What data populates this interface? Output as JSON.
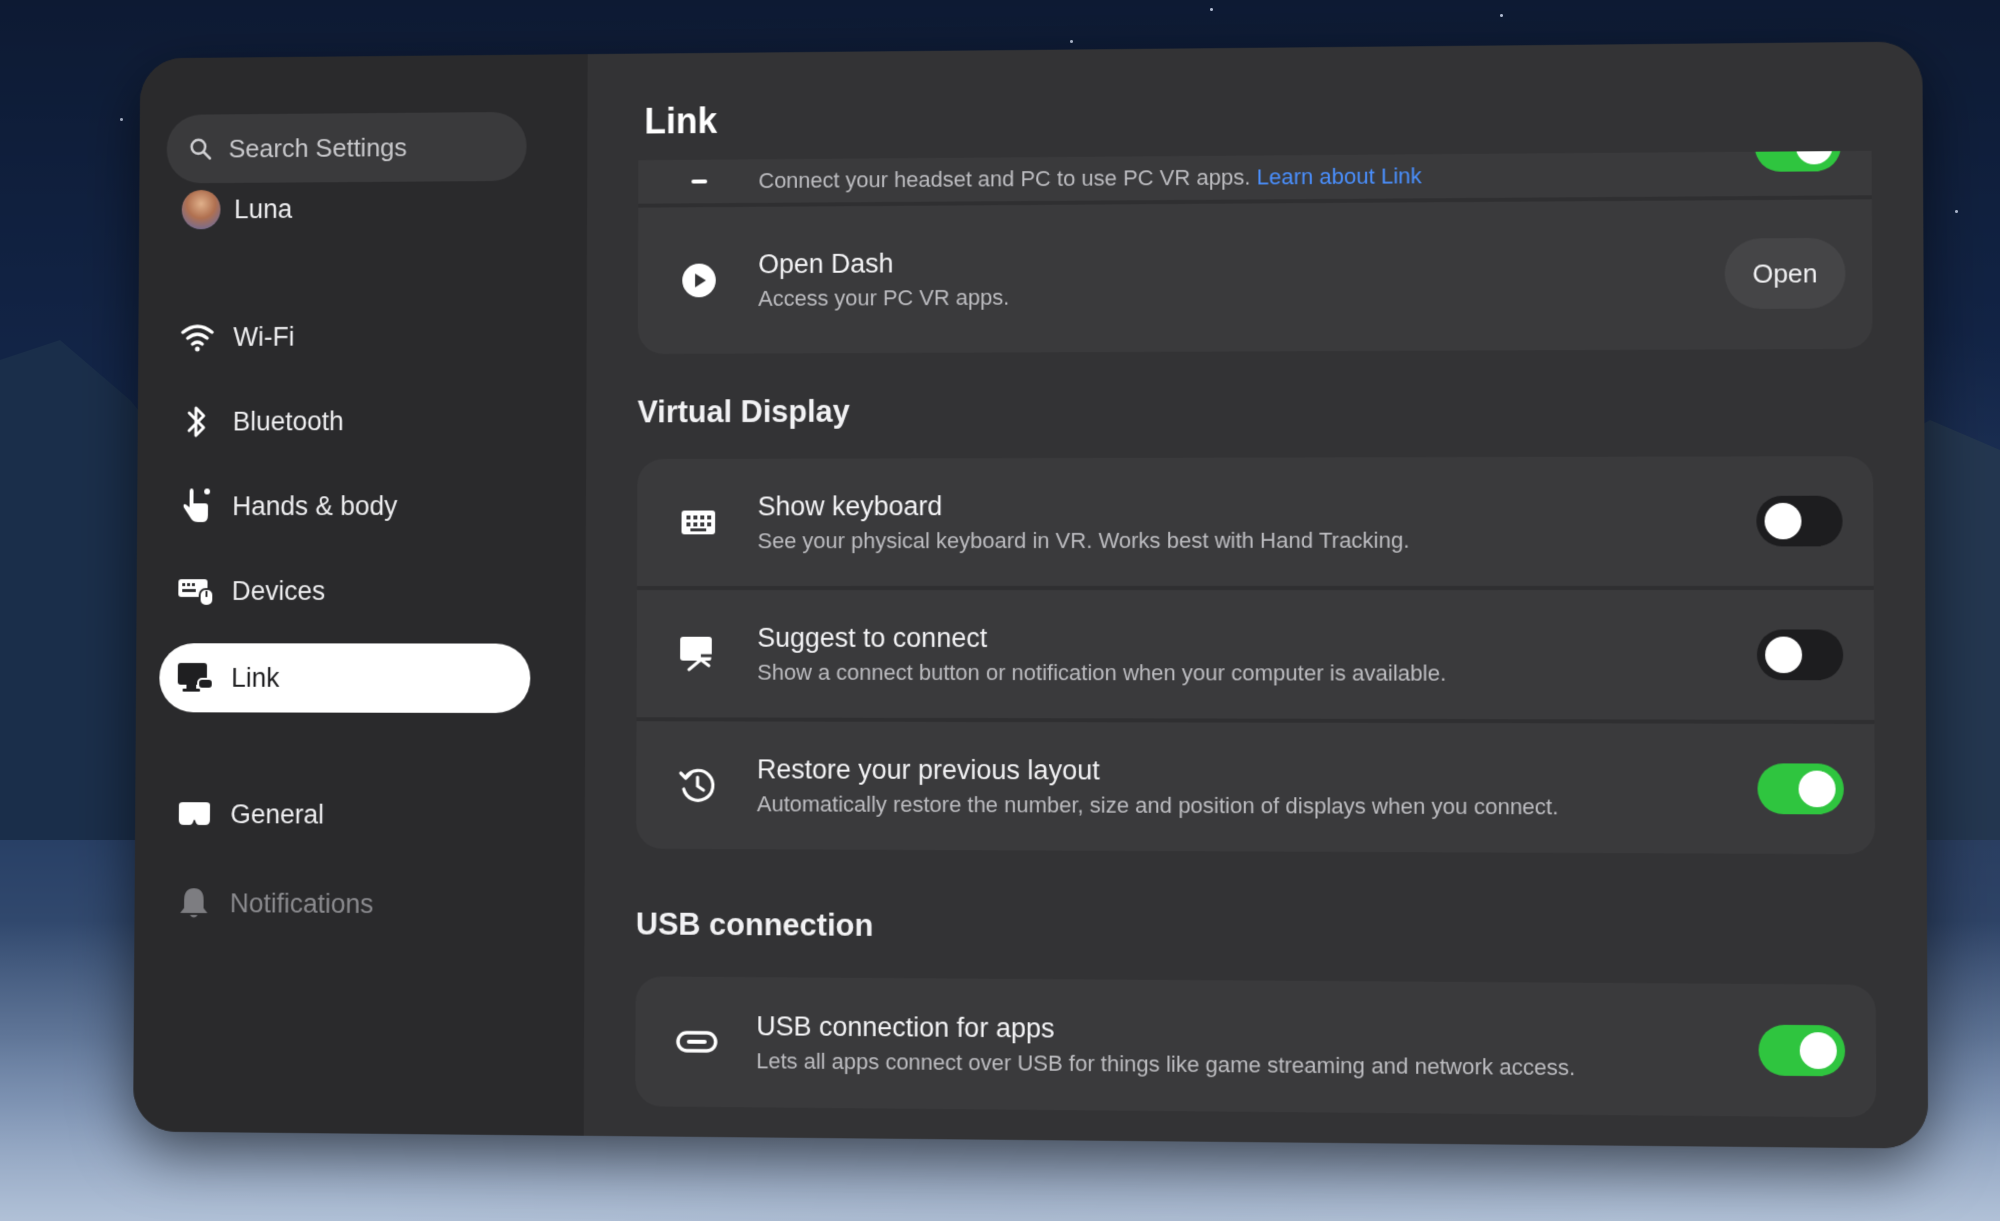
{
  "search": {
    "placeholder": "Search Settings",
    "icon": "search-icon"
  },
  "profile": {
    "name": "Luna"
  },
  "sidebar": {
    "items": [
      {
        "label": "Wi-Fi",
        "icon": "wifi-icon"
      },
      {
        "label": "Bluetooth",
        "icon": "bluetooth-icon"
      },
      {
        "label": "Hands & body",
        "icon": "hand-icon"
      },
      {
        "label": "Devices",
        "icon": "devices-icon"
      },
      {
        "label": "Link",
        "icon": "link-monitor-icon",
        "active": true
      },
      {
        "label": "General",
        "icon": "headset-icon"
      },
      {
        "label": "Notifications",
        "icon": "bell-icon",
        "dimmed": true
      }
    ]
  },
  "main": {
    "title": "Link",
    "link_card": {
      "partial_row": {
        "subtitle": "Connect your headset and PC to use PC VR apps.",
        "link_text": "Learn about Link",
        "toggle_on": true
      },
      "open_dash": {
        "title": "Open Dash",
        "subtitle": "Access your PC VR apps.",
        "button": "Open"
      }
    },
    "virtual_display": {
      "heading": "Virtual Display",
      "rows": [
        {
          "title": "Show keyboard",
          "subtitle": "See your physical keyboard in VR. Works best with Hand Tracking.",
          "icon": "keyboard-icon",
          "toggle_on": false
        },
        {
          "title": "Suggest to connect",
          "subtitle": "Show a connect button or notification when your computer is available.",
          "icon": "monitor-connect-icon",
          "toggle_on": false
        },
        {
          "title": "Restore your previous layout",
          "subtitle": "Automatically restore the number, size and position of displays when you connect.",
          "icon": "history-icon",
          "toggle_on": true
        }
      ]
    },
    "usb": {
      "heading": "USB connection",
      "row": {
        "title": "USB connection for apps",
        "subtitle": "Lets all apps connect over USB for things like game streaming and network access.",
        "icon": "usb-icon",
        "toggle_on": true
      }
    }
  },
  "colors": {
    "toggle_on": "#2fc53f",
    "link": "#4a90ff",
    "panel": "#333335",
    "sidebar": "#2a2a2c"
  }
}
